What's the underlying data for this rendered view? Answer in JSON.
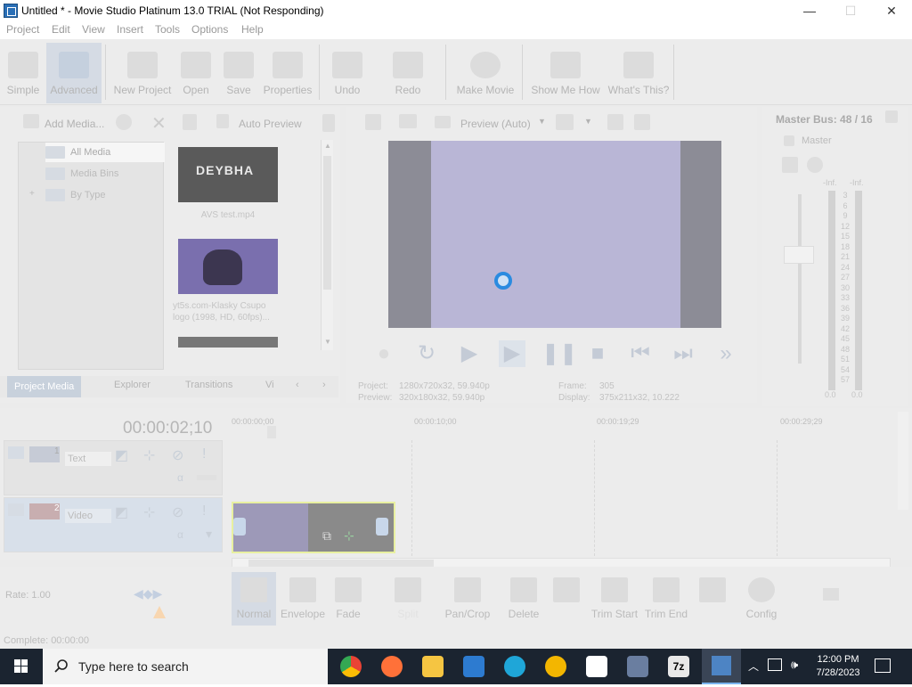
{
  "window": {
    "title": "Untitled * - Movie Studio Platinum 13.0 TRIAL (Not Responding)",
    "minimize": "—",
    "maximize": "☐",
    "close": "✕"
  },
  "menu": [
    "Project",
    "Edit",
    "View",
    "Insert",
    "Tools",
    "Options",
    "Help"
  ],
  "toolbar": {
    "simple": "Simple",
    "advanced": "Advanced",
    "new_project": "New Project",
    "open": "Open",
    "save": "Save",
    "properties": "Properties",
    "undo": "Undo",
    "redo": "Redo",
    "make_movie": "Make Movie",
    "show_me_how": "Show Me How",
    "whats_this": "What's This?"
  },
  "media": {
    "add_media": "Add Media...",
    "auto_preview": "Auto Preview",
    "tree": [
      "All Media",
      "Media Bins",
      "By Type"
    ],
    "tree_expander": "+",
    "items": [
      {
        "thumb_text": "DEYBHA",
        "caption": "AVS test.mp4"
      },
      {
        "caption": "yt5s.com-Klasky Csupo logo (1998, HD, 60fps)..."
      }
    ],
    "tabs": [
      "Project Media",
      "Explorer",
      "Transitions",
      "Vi"
    ]
  },
  "preview": {
    "mode": "Preview (Auto)",
    "project_label": "Project:",
    "project_value": "1280x720x32, 59.940p",
    "preview_label": "Preview:",
    "preview_value": "320x180x32, 59.940p",
    "frame_label": "Frame:",
    "frame_value": "305",
    "display_label": "Display:",
    "display_value": "375x211x32, 10.222"
  },
  "master": {
    "title": "Master Bus: 48 / 16",
    "label": "Master",
    "inf_left": "-Inf.",
    "inf_right": "-Inf.",
    "scale": [
      "3",
      "6",
      "9",
      "12",
      "15",
      "18",
      "21",
      "24",
      "27",
      "30",
      "33",
      "36",
      "39",
      "42",
      "45",
      "48",
      "51",
      "54",
      "57"
    ],
    "bottom_left": "0.0",
    "bottom_right": "0.0"
  },
  "timeline": {
    "timecode": "00:00:02;10",
    "ruler": [
      "00:00:00;00",
      "00:00:10;00",
      "00:00:19;29",
      "00:00:29;29"
    ],
    "tracks": [
      {
        "number": "1",
        "name": "Text"
      },
      {
        "number": "2",
        "name": "Video"
      }
    ]
  },
  "bottom": {
    "rate": "Rate: 1.00",
    "tools": [
      "Normal",
      "Envelope",
      "Fade",
      "Split",
      "Pan/Crop",
      "Delete",
      "Trim Start",
      "Trim End",
      "Config"
    ],
    "status": "Complete: 00:00:00"
  },
  "taskbar": {
    "search_placeholder": "Type here to search",
    "time": "12:00 PM",
    "date": "7/28/2023"
  }
}
